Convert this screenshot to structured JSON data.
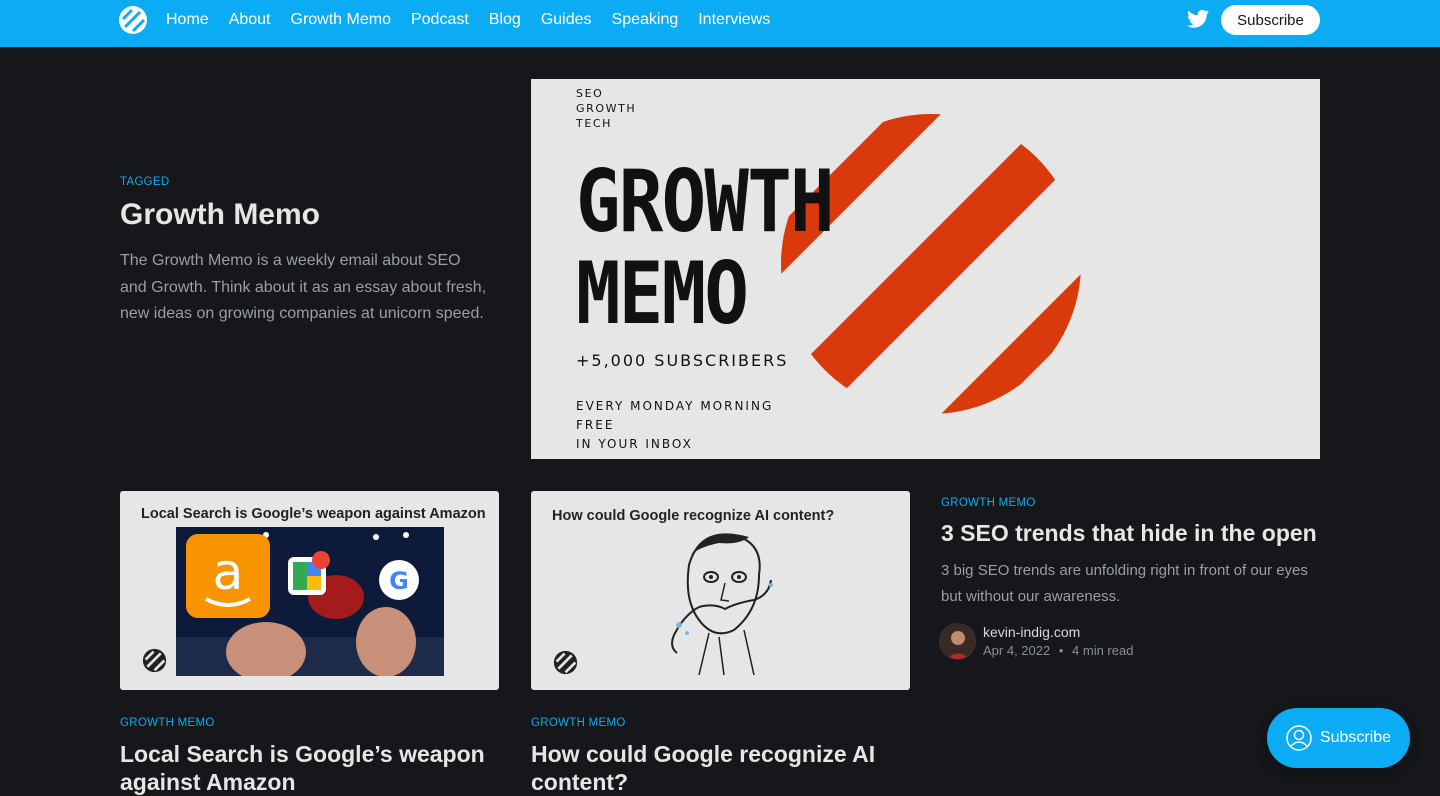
{
  "nav": {
    "links": [
      "Home",
      "About",
      "Growth Memo",
      "Podcast",
      "Blog",
      "Guides",
      "Speaking",
      "Interviews"
    ],
    "subscribe_label": "Subscribe"
  },
  "hero": {
    "tag": "TAGGED",
    "title": "Growth Memo",
    "description": "The Growth Memo is a weekly email about SEO and Growth. Think about it as an essay about fresh, new ideas on growing companies at unicorn speed.",
    "image": {
      "top_lines": [
        "SEO",
        "GROWTH",
        "TECH"
      ],
      "big_lines": [
        "GROWTH",
        "MEMO"
      ],
      "subscribers": "+5,000 SUBSCRIBERS",
      "bottom_lines": [
        "EVERY MONDAY MORNING",
        "FREE",
        "IN YOUR INBOX"
      ]
    }
  },
  "cards": [
    {
      "image_caption": "Local Search is Google’s weapon against Amazon",
      "tag": "GROWTH MEMO",
      "title": "Local Search is Google’s weapon against Amazon"
    },
    {
      "image_caption": "How could Google recognize AI content?",
      "tag": "GROWTH MEMO",
      "title": "How could Google recognize AI content?"
    }
  ],
  "featured_post": {
    "tag": "GROWTH MEMO",
    "title": "3 SEO trends that hide in the open",
    "description": "3 big SEO trends are unfolding right in front of our eyes but without our awareness.",
    "author": "kevin-indig.com",
    "date": "Apr 4, 2022",
    "separator": "•",
    "read_time": "4 min read"
  },
  "float_subscribe": {
    "label": "Subscribe"
  },
  "colors": {
    "accent": "#0bacf3",
    "background": "#15171a",
    "brand_red": "#d93a0c"
  }
}
